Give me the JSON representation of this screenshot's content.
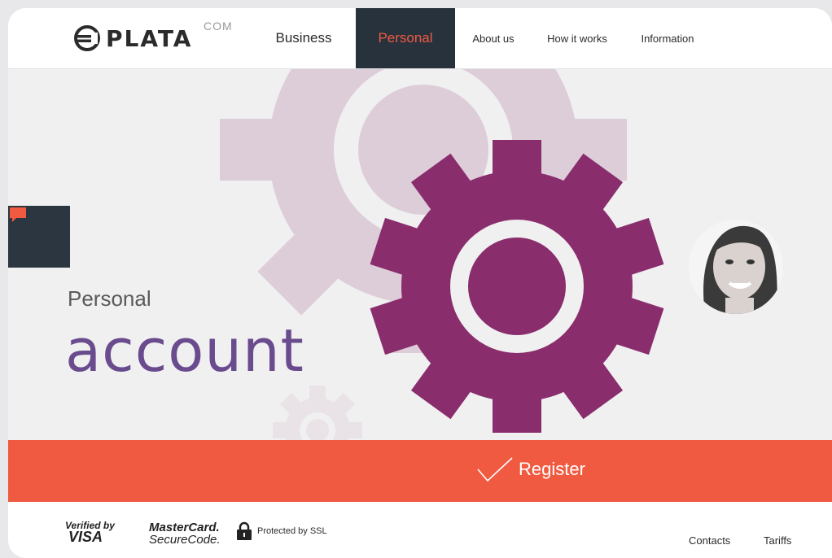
{
  "brand": {
    "name": "PLATA",
    "suffix": "COM"
  },
  "nav": {
    "business": "Business",
    "personal": "Personal",
    "about": "About us",
    "how": "How it works",
    "info": "Information"
  },
  "hero": {
    "subtitle": "Personal",
    "title": "account"
  },
  "register": {
    "label": "Register"
  },
  "footer": {
    "visa_top": "Verified by",
    "visa_bottom": "VISA",
    "mc_top": "MasterCard.",
    "mc_bottom": "SecureCode.",
    "ssl": "Protected by SSL",
    "contacts": "Contacts",
    "tariffs": "Tariffs"
  },
  "colors": {
    "accent": "#f05a40",
    "dark": "#27323d",
    "gear_main": "#8a2d6d",
    "gear_light": "#ddcdd9",
    "headline": "#6a4c8e"
  },
  "icons": {
    "chat": "chat-bubble-icon",
    "register": "checkmark-icon",
    "ssl": "padlock-icon",
    "logo": "euro-circle-icon"
  }
}
